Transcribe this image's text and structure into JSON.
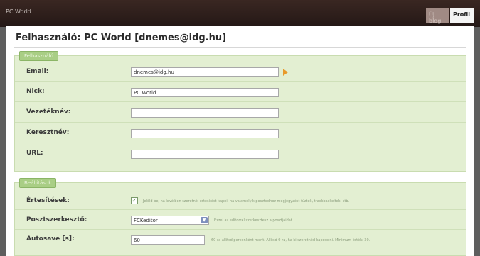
{
  "topbar": {
    "app_title": "PC World",
    "tabs": [
      {
        "label": "Új blog"
      },
      {
        "label": "Profil",
        "active": true
      }
    ]
  },
  "page": {
    "heading": "Felhasználó: PC World [dnemes@idg.hu]"
  },
  "section1": {
    "legend": "Felhasználó",
    "fields": [
      {
        "label": "Email:",
        "value": "dnemes@idg.hu"
      },
      {
        "label": "Nick:",
        "value": "PC World"
      },
      {
        "label": "Vezetéknév:",
        "value": ""
      },
      {
        "label": "Keresztnév:",
        "value": ""
      },
      {
        "label": "URL:",
        "value": ""
      }
    ]
  },
  "section2": {
    "legend": "Beállítások",
    "notifications": {
      "label": "Értesítések:",
      "checked": true,
      "hint": "Jelöld be, ha levélben szeretnél értesítést kapni, ha valamelyik posztodhoz megjegyzést fűztek, trackbackeltek, stb."
    },
    "editor": {
      "label": "Posztszerkesztő:",
      "selected": "FCKeditor",
      "hint": "Ezzel az editorral szerkesztesz a posztjaidat."
    },
    "autosave": {
      "label": "Autosave [s]:",
      "value": "60",
      "hint": "60-ra állítsd percenként ment. Állítsd 0-ra, ha ki szeretnéd kapcsolni. Minimum érték: 30."
    }
  },
  "colors": {
    "topbar": "#2c1d1a",
    "fieldset_bg": "#e3efd2",
    "legend_bg": "#a9ce85",
    "arrow": "#e89a2a"
  }
}
